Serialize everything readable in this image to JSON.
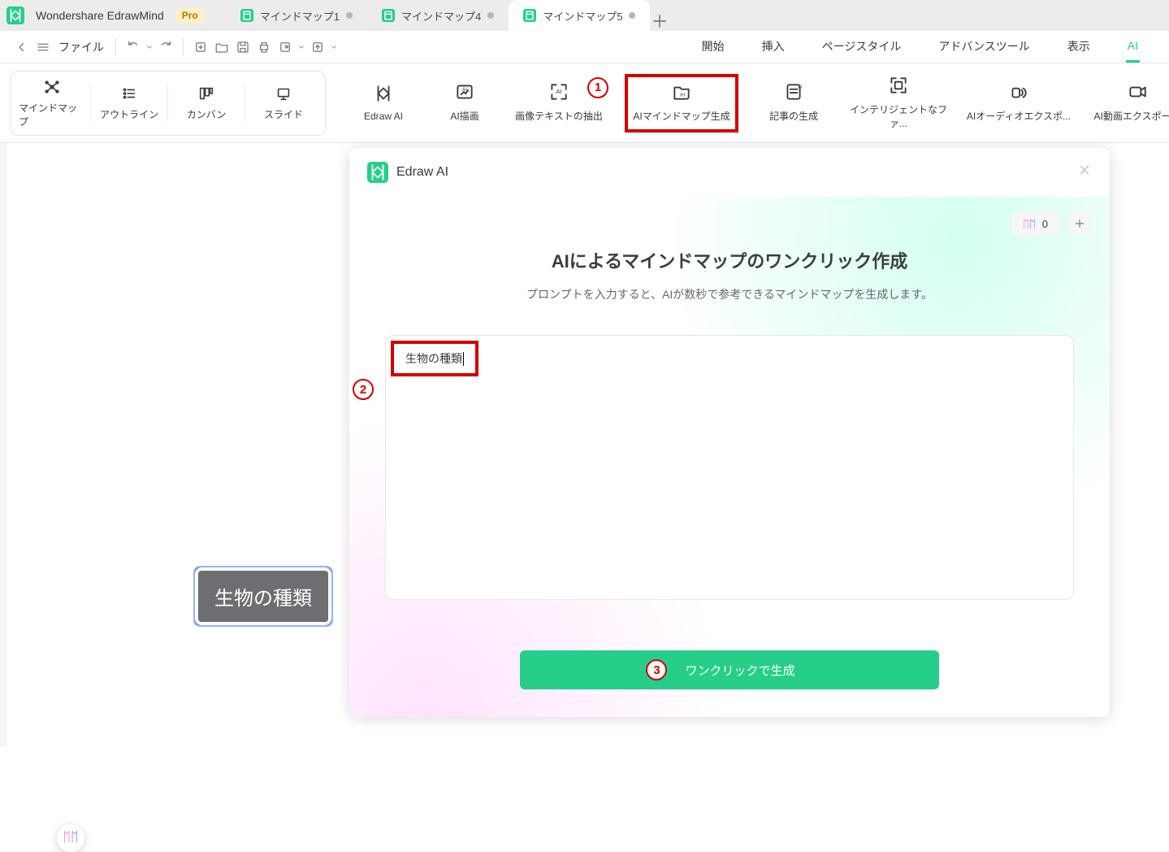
{
  "app": {
    "title": "Wondershare EdrawMind",
    "pro": "Pro"
  },
  "tabs": [
    {
      "label": "マインドマップ1"
    },
    {
      "label": "マインドマップ4"
    },
    {
      "label": "マインドマップ5"
    }
  ],
  "menubar": {
    "file": "ファイル"
  },
  "top_menu": [
    "開始",
    "挿入",
    "ページスタイル",
    "アドバンスツール",
    "表示",
    "AI"
  ],
  "view_modes": [
    "マインドマップ",
    "アウトライン",
    "カンバン",
    "スライド"
  ],
  "ai_ribbon": [
    "Edraw AI",
    "AI描画",
    "画像テキストの抽出",
    "AIマインドマップ生成",
    "記事の生成",
    "インテリジェントなファ...",
    "AIオーディオエクスポ...",
    "AI動画エクスポート"
  ],
  "canvas": {
    "root_node": "生物の種類"
  },
  "panel": {
    "brand": "Edraw AI",
    "title": "AIによるマインドマップのワンクリック作成",
    "subtitle": "プロンプトを入力すると、AIが数秒で参考できるマインドマップを生成します。",
    "prompt_value": "生物の種類",
    "button": "ワンクリックで生成",
    "credits": "0"
  },
  "markers": {
    "one": "1",
    "two": "2",
    "three": "3"
  }
}
